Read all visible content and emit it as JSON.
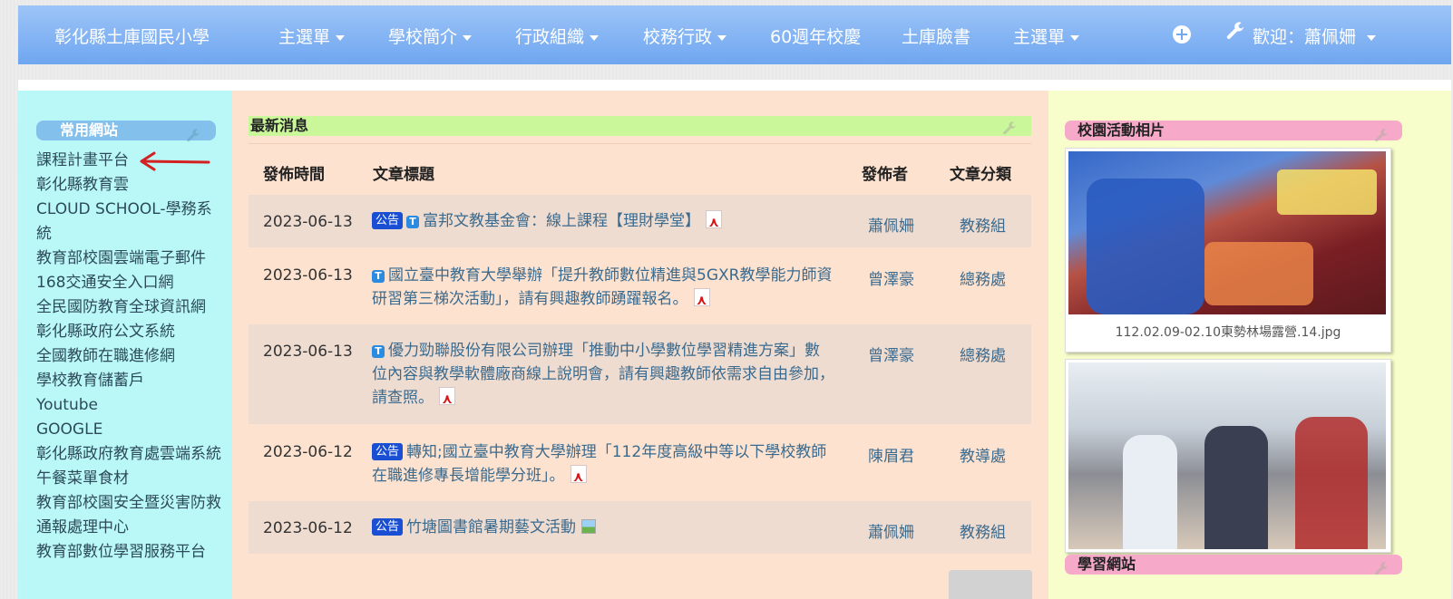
{
  "nav": {
    "brand": "彰化縣土庫國民小學",
    "items": [
      {
        "label": "主選單",
        "dropdown": true
      },
      {
        "label": "學校簡介",
        "dropdown": true
      },
      {
        "label": "行政組織",
        "dropdown": true
      },
      {
        "label": "校務行政",
        "dropdown": true
      },
      {
        "label": "60週年校慶",
        "dropdown": false
      },
      {
        "label": "土庫臉書",
        "dropdown": false
      },
      {
        "label": "主選單",
        "dropdown": true
      }
    ],
    "welcome": "歡迎：蕭佩姍",
    "nav_color": "#7fb0f2"
  },
  "left": {
    "title": "常用網站",
    "links": [
      "課程計畫平台",
      "彰化縣教育雲",
      "CLOUD SCHOOL-學務系統",
      "教育部校園雲端電子郵件",
      "168交通安全入口網",
      "全民國防教育全球資訊網",
      "彰化縣政府公文系統",
      "全國教師在職進修網",
      "學校教育儲蓄戶",
      "Youtube",
      "GOOGLE",
      "彰化縣政府教育處雲端系統",
      "午餐菜單食材",
      "教育部校園安全暨災害防救通報處理中心",
      "教育部數位學習服務平台"
    ]
  },
  "news": {
    "title": "最新消息",
    "headers": {
      "date": "發佈時間",
      "title": "文章標題",
      "author": "發佈者",
      "category": "文章分類"
    },
    "rows": [
      {
        "date": "2023-06-13",
        "badge": "公告",
        "t": true,
        "title": "富邦文教基金會：線上課程【理財學堂】",
        "attach": "pdf",
        "author": "蕭佩姍",
        "category": "教務組"
      },
      {
        "date": "2023-06-13",
        "badge": "",
        "t": true,
        "title": "國立臺中教育大學舉辦「提升教師數位精進與5GXR教學能力師資研習第三梯次活動」，請有興趣教師踴躍報名。",
        "attach": "pdf",
        "author": "曾澤豪",
        "category": "總務處"
      },
      {
        "date": "2023-06-13",
        "badge": "",
        "t": true,
        "title": "優力勁聯股份有限公司辦理「推動中小學數位學習精進方案」數位內容與教學軟體廠商線上說明會，請有興趣教師依需求自由參加，請查照。",
        "attach": "pdf",
        "author": "曾澤豪",
        "category": "總務處"
      },
      {
        "date": "2023-06-12",
        "badge": "公告",
        "t": false,
        "title": "轉知;國立臺中教育大學辦理「112年度高級中等以下學校教師在職進修專長增能學分班」。",
        "attach": "pdf",
        "author": "陳眉君",
        "category": "教導處"
      },
      {
        "date": "2023-06-12",
        "badge": "公告",
        "t": false,
        "title": "竹塘圖書館暑期藝文活動",
        "attach": "image",
        "author": "蕭佩姍",
        "category": "教務組"
      }
    ]
  },
  "right": {
    "photo_title": "校園活動相片",
    "photo_caption": "112.02.09-02.10東勢林場露營.14.jpg",
    "links_title": "學習網站"
  },
  "colors": {
    "left_bg": "#baf8f8",
    "center_bg": "#fde2cf",
    "right_bg": "#f8fdcc",
    "badge": "#1a4fd4",
    "link": "#3a6a8e"
  }
}
